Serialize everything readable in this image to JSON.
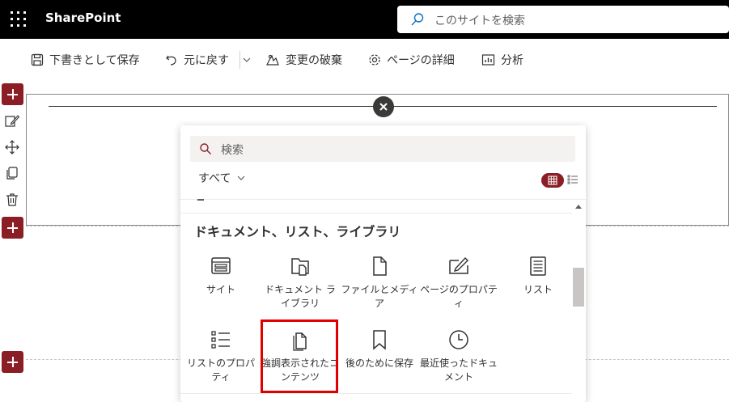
{
  "header": {
    "brand": "SharePoint",
    "search_placeholder": "このサイトを検索"
  },
  "toolbar": {
    "save_draft": "下書きとして保存",
    "undo": "元に戻す",
    "discard": "変更の破棄",
    "page_details": "ページの詳細",
    "analytics": "分析"
  },
  "picker": {
    "search_placeholder": "検索",
    "filter_label": "すべて",
    "category_title": "ドキュメント、リスト、ライブラリ",
    "tiles": [
      {
        "label": "サイト",
        "icon": "site-icon"
      },
      {
        "label": "ドキュメント ライブラリ",
        "icon": "document-library-icon"
      },
      {
        "label": "ファイルとメディア",
        "icon": "file-icon"
      },
      {
        "label": "ページのプロパティ",
        "icon": "page-properties-icon"
      },
      {
        "label": "リスト",
        "icon": "list-icon"
      },
      {
        "label": "リストのプロパティ",
        "icon": "list-properties-icon"
      },
      {
        "label": "強調表示されたコンテンツ",
        "icon": "highlighted-content-icon"
      },
      {
        "label": "後のために保存",
        "icon": "bookmark-icon"
      },
      {
        "label": "最近使ったドキュメント",
        "icon": "clock-icon"
      }
    ]
  },
  "colors": {
    "accent": "#8b1d25",
    "highlight_border": "#e00000",
    "topbar": "#000000"
  }
}
